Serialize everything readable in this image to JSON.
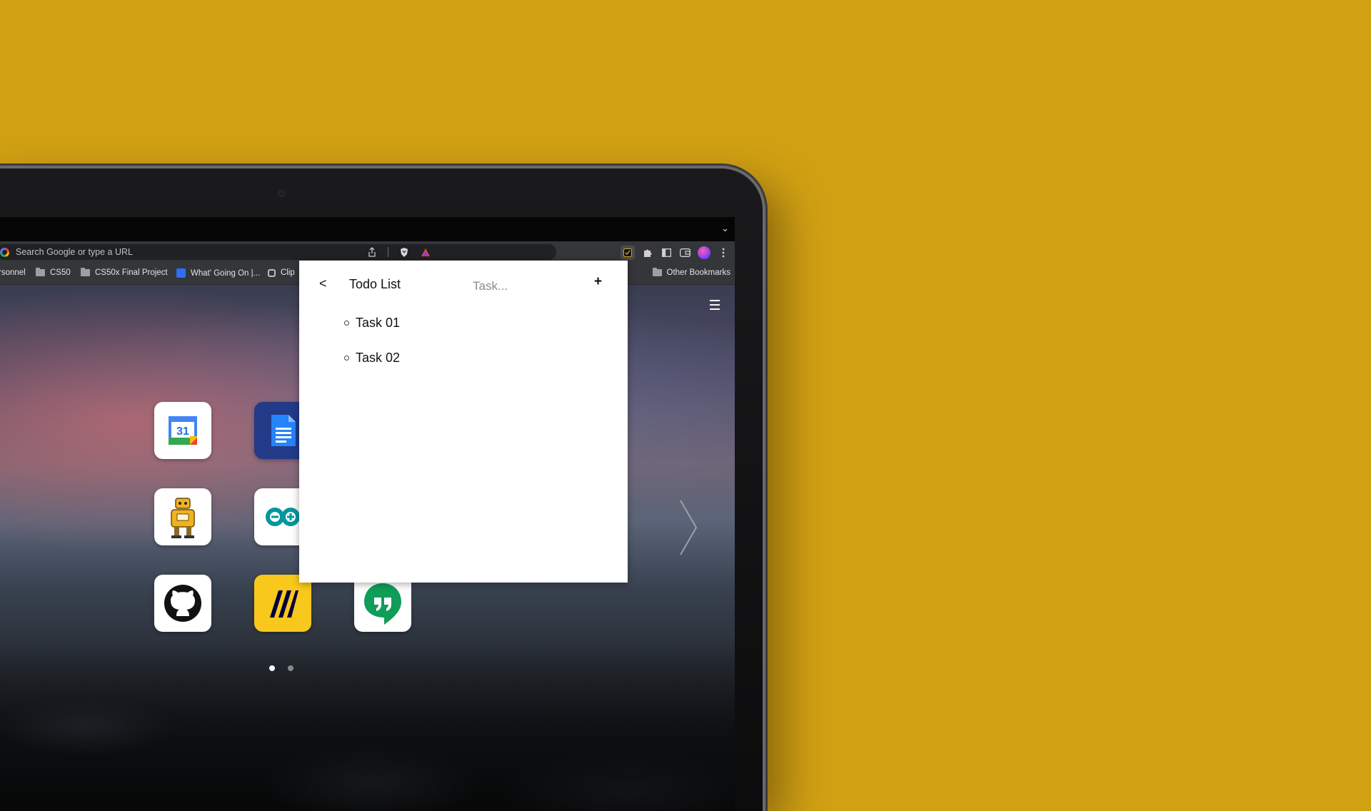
{
  "browser": {
    "omnibox_placeholder": "Search Google or type a URL",
    "bookmarks": [
      {
        "label": "rsonnel",
        "icon": "none"
      },
      {
        "label": "CS50",
        "icon": "folder-icon"
      },
      {
        "label": "CS50x Final Project",
        "icon": "folder-icon"
      },
      {
        "label": "What' Going On |...",
        "icon": "blue-app-icon"
      },
      {
        "label": "Clip",
        "icon": "clipchamp-icon"
      }
    ],
    "other_bookmarks": "Other Bookmarks"
  },
  "todo": {
    "back_label": "<",
    "title": "Todo List",
    "input_placeholder": "Task...",
    "add_label": "+",
    "tasks": [
      "Task 01",
      "Task 02"
    ]
  },
  "launcher": {
    "calendar_day": "31",
    "page_count": 2,
    "active_page": 1
  },
  "colors": {
    "background": "#d1a013",
    "popup": "#ffffff",
    "toolbar": "#35363a"
  }
}
